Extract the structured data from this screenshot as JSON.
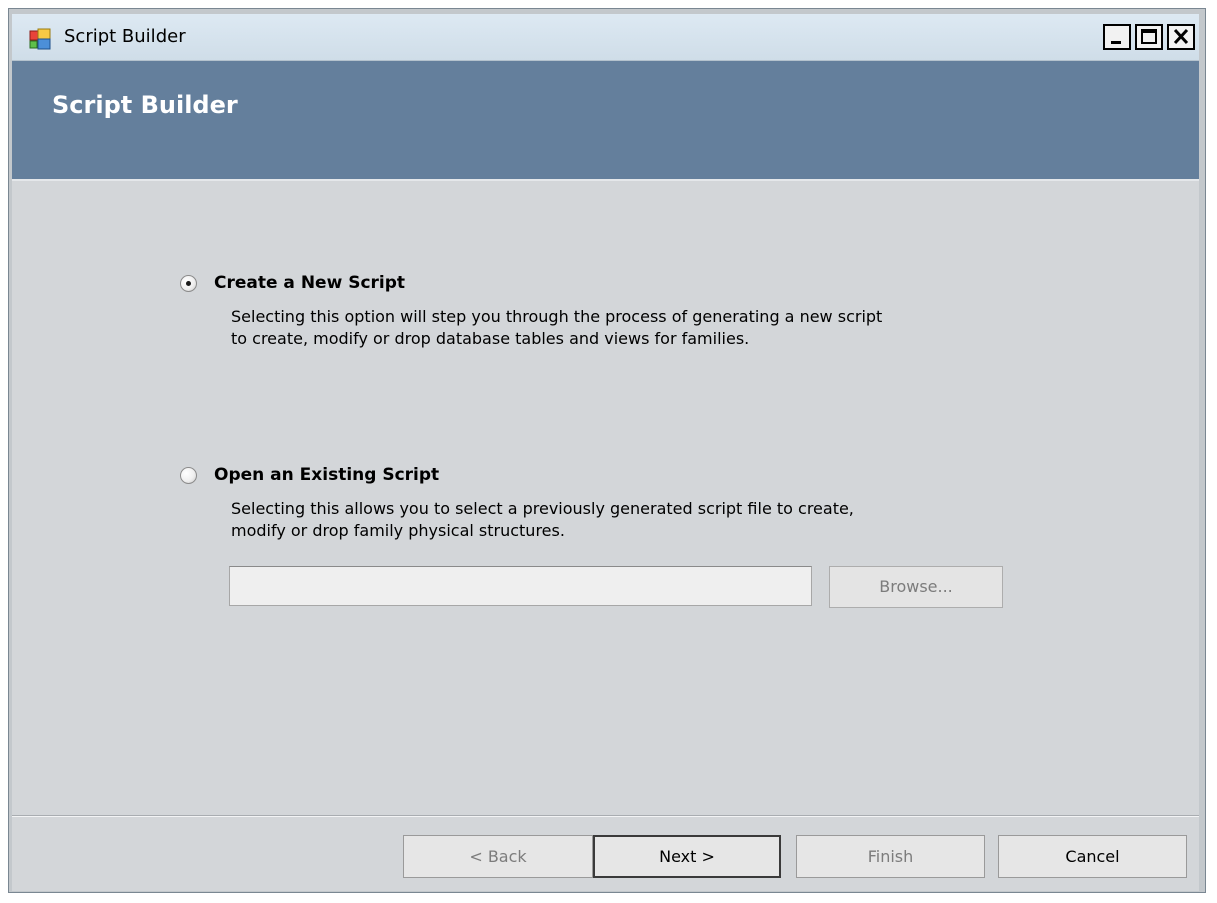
{
  "window": {
    "title": "Script Builder",
    "controls": {
      "minimize": "minimize",
      "maximize": "maximize",
      "close": "close"
    }
  },
  "banner": {
    "title": "Script Builder"
  },
  "options": [
    {
      "label": "Create a New Script",
      "checked": true,
      "description": [
        "Selecting this option will step you through the process of generating a new script",
        "to create, modify or drop database tables and views for families."
      ]
    },
    {
      "label": "Open an Existing Script",
      "checked": false,
      "description": [
        "Selecting this allows you to select a previously generated script file to create,",
        "modify or drop family physical structures."
      ]
    }
  ],
  "file_picker": {
    "value": "",
    "browse_label": "Browse..."
  },
  "footer": {
    "back_label": "< Back",
    "next_label": "Next >",
    "finish_label": "Finish",
    "cancel_label": "Cancel"
  },
  "colors": {
    "banner": "#647f9c",
    "content": "#d3d6d9",
    "titlebar": "#dde9f3"
  }
}
